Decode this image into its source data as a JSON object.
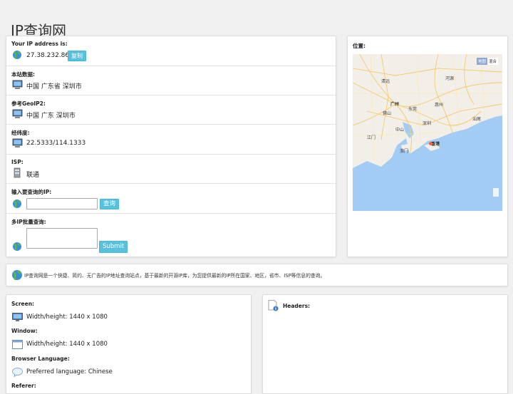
{
  "page": {
    "title": "IP查询网"
  },
  "info": {
    "ip_label": "Your IP address is:",
    "ip_value": "27.38.232.86",
    "copy_button": "复制",
    "site_data_label": "本站数据:",
    "site_data_value": "中国 广东省 深圳市",
    "geoip_label": "参考GeoIP2:",
    "geoip_value": "中国 广东 深圳市",
    "latlng_label": "经纬度:",
    "latlng_value": "22.5333/114.1333",
    "isp_label": "ISP:",
    "isp_value": "联通",
    "query_label": "输入要查询的IP:",
    "query_input_value": "",
    "query_button": "查询",
    "batch_label": "多IP批量查询:",
    "batch_input_value": "",
    "submit_button": "Submit"
  },
  "map": {
    "label": "位置:",
    "type_map": "地图",
    "type_hybrid": "混合",
    "places": [
      "清远",
      "河源",
      "广州",
      "佛山",
      "东莞",
      "惠州",
      "深圳",
      "中山",
      "汕尾",
      "江门",
      "香港",
      "澳门"
    ]
  },
  "description": "IP查询网是一个快捷、简约、无广告的IP地址查询站点，基于最新的开源IP库，为您提供最新的IP所在国家、地区，省市、ISP等信息的查询。",
  "client": {
    "screen_label": "Screen:",
    "screen_value": "Width/height: 1440 x 1080",
    "window_label": "Window:",
    "window_value": "Width/height: 1440 x 1080",
    "language_label": "Browser Language:",
    "language_value": "Preferred language: Chinese",
    "referer_label": "Referer:"
  },
  "headers": {
    "label": "Headers:"
  },
  "colors": {
    "accent": "#5bc0de",
    "sea": "#a3ccf5",
    "land": "#f2efe9"
  }
}
